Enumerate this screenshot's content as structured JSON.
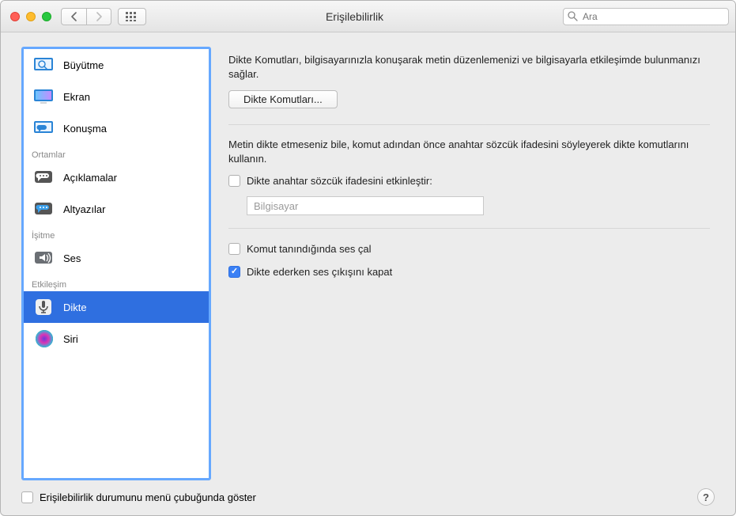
{
  "window": {
    "title": "Erişilebilirlik"
  },
  "toolbar": {
    "search_placeholder": "Ara"
  },
  "sidebar": {
    "items": [
      {
        "label": "Büyütme"
      },
      {
        "label": "Ekran"
      },
      {
        "label": "Konuşma"
      }
    ],
    "section_media": "Ortamlar",
    "media_items": [
      {
        "label": "Açıklamalar"
      },
      {
        "label": "Altyazılar"
      }
    ],
    "section_hearing": "İşitme",
    "hearing_items": [
      {
        "label": "Ses"
      }
    ],
    "section_interaction": "Etkileşim",
    "interaction_items": [
      {
        "label": "Dikte"
      },
      {
        "label": "Siri"
      }
    ]
  },
  "detail": {
    "intro": "Dikte Komutları, bilgisayarınızla konuşarak metin düzenlemenizi ve bilgisayarla etkileşimde bulunmanızı sağlar.",
    "commands_button": "Dikte Komutları...",
    "keyword_desc": "Metin dikte etmeseniz bile, komut adından önce anahtar sözcük ifadesini söyleyerek dikte komutlarını kullanın.",
    "enable_keyword_label": "Dikte anahtar sözcük ifadesini etkinleştir:",
    "keyword_value": "Bilgisayar",
    "play_sound_label": "Komut tanındığında ses çal",
    "mute_output_label": "Dikte ederken ses çıkışını kapat"
  },
  "footer": {
    "menubar_label": "Erişilebilirlik durumunu menü çubuğunda göster",
    "help": "?"
  },
  "colors": {
    "selection": "#2f6fe0",
    "accent": "#66a8ff"
  }
}
